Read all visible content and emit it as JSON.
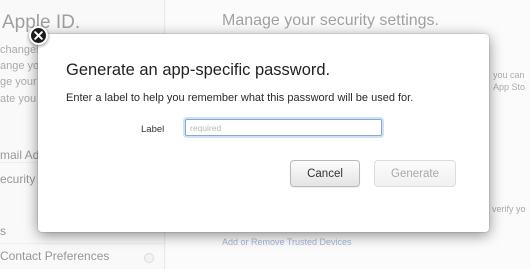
{
  "background": {
    "brand_fragment": "Apple ID.",
    "sidebar_lines": [
      "changes",
      "ange you",
      "ge your",
      "ate you"
    ],
    "sidebar_nav": [
      "mail Ad",
      "ecurity",
      "s",
      "Contact Preferences"
    ],
    "main_title": "Manage your security settings.",
    "main_lines": [
      "you can",
      "App Sto",
      "verify yo"
    ],
    "trusted_devices_link": "Add or Remove Trusted Devices"
  },
  "dialog": {
    "title": "Generate an app-specific password.",
    "description": "Enter a label to help you remember what this password will be used for.",
    "label_caption": "Label",
    "label_placeholder": "required",
    "label_value": "",
    "cancel_label": "Cancel",
    "generate_label": "Generate",
    "close_icon": "close-icon"
  }
}
